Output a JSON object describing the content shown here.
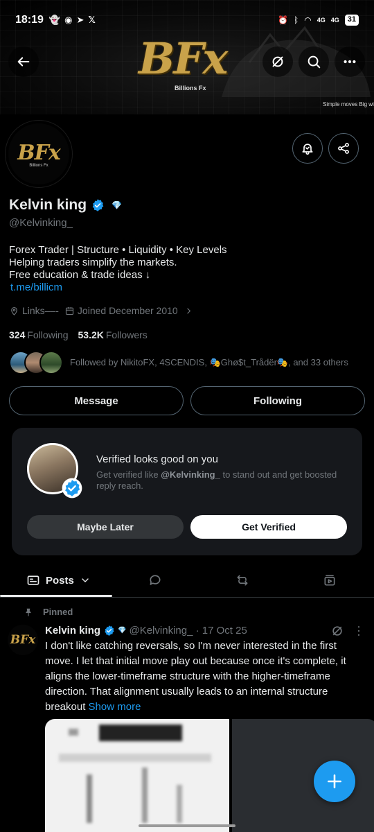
{
  "status_bar": {
    "time": "18:19",
    "left_icons": [
      "snapchat-icon",
      "discord-icon",
      "telegram-icon",
      "x-icon"
    ],
    "right_icons": [
      "alarm-icon",
      "bluetooth-icon",
      "wifi-icon",
      "signal-4g-icon",
      "signal-4g-icon"
    ],
    "network_1": "4G",
    "network_2": "4G",
    "battery": "31"
  },
  "banner": {
    "logo_text": "BFx",
    "logo_subtitle": "Billions Fx",
    "tagline": "Simple moves Big wi"
  },
  "avatar": {
    "logo_text": "BFx",
    "logo_subtitle": "Billions Fx"
  },
  "profile": {
    "name": "Kelvin king",
    "handle": "@Kelvinking_",
    "bio_lines": [
      "Forex Trader | Structure • Liquidity • Key Levels",
      "Helping traders simplify the markets.",
      "Free education & trade ideas ↓"
    ],
    "bio_link": "t.me/billicm",
    "links_label": "Links––-",
    "joined": "Joined December 2010",
    "following_count": "324",
    "following_label": "Following",
    "followers_count": "53.2K",
    "followers_label": "Followers",
    "followed_by": "Followed by NikitoFX, 4SCENDIS, 🎭Ghø$t_Trådër🎭, and 33 others"
  },
  "actions": {
    "message": "Message",
    "following": "Following"
  },
  "verify_card": {
    "title": "Verified looks good on you",
    "desc_prefix": "Get verified like ",
    "desc_handle": "@Kelvinking_",
    "desc_suffix": " to stand out and get boosted reply reach.",
    "maybe_later": "Maybe Later",
    "get_verified": "Get Verified"
  },
  "tabs": {
    "posts": "Posts"
  },
  "post": {
    "pinned_label": "Pinned",
    "avatar_text": "BFx",
    "author": "Kelvin king",
    "meta": "@Kelvinking_ · 17 Oct 25",
    "text": "I don't like catching reversals, so I'm never interested in the first move. I let that initial move play out because once it's complete, it aligns the lower-timeframe structure with the higher-timeframe direction. That alignment usually leads to an internal structure breakout ",
    "show_more": "Show more"
  },
  "colors": {
    "accent": "#1d9bf0",
    "gold": "#c9a24a",
    "muted": "#71767b",
    "card": "#16181c"
  }
}
